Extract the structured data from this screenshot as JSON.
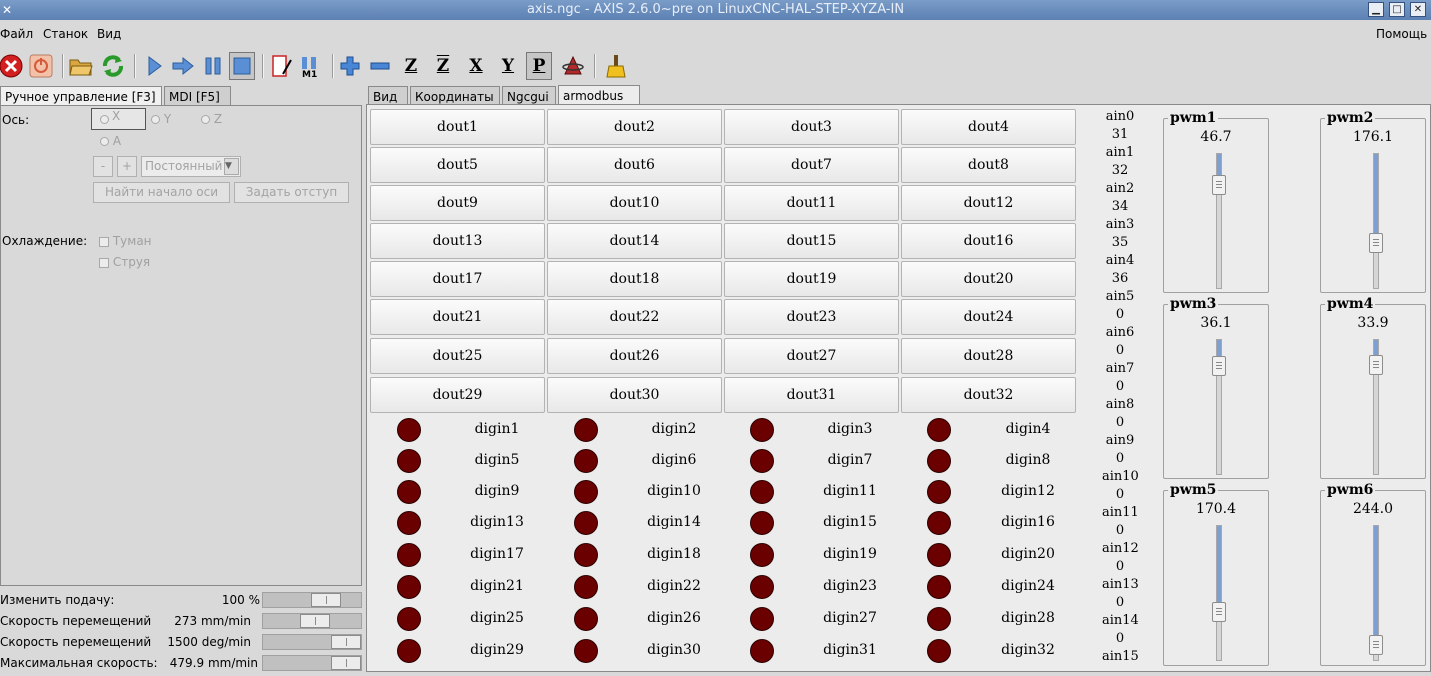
{
  "window": {
    "title": "axis.ngc - AXIS 2.6.0~pre on LinuxCNC-HAL-STEP-XYZA-IN"
  },
  "menubar": {
    "items": [
      "Файл",
      "Станок",
      "Вид"
    ],
    "help": "Помощь"
  },
  "toolbar": {
    "icons": [
      "estop-icon",
      "power-icon",
      "open-file-icon",
      "reload-icon",
      "run-icon",
      "step-icon",
      "pause-icon",
      "stop-icon",
      "block-delete-icon",
      "optional-stop-icon",
      "zoom-in-icon",
      "zoom-out-icon",
      "view-z-icon",
      "view-z2-icon",
      "view-x-icon",
      "view-y-icon",
      "view-p-icon",
      "rotate-icon",
      "clear-live-plot-icon"
    ],
    "view_labels": [
      "Z",
      "Z",
      "X",
      "Y",
      "P"
    ]
  },
  "left_tabs": [
    "Ручное управление [F3]",
    "MDI [F5]"
  ],
  "manual": {
    "axis_label": "Ось:",
    "axes": [
      "X",
      "Y",
      "Z",
      "A"
    ],
    "minus": "-",
    "plus": "+",
    "jog_mode": "Постоянный",
    "home_btn": "Найти начало оси",
    "touch_off_btn": "Задать отступ",
    "coolant_label": "Охлаждение:",
    "mist": "Туман",
    "flood": "Струя"
  },
  "sliders": [
    {
      "label": "Изменить подачу:",
      "value": "100 %",
      "level": 0.7
    },
    {
      "label": "Скорость перемещений",
      "value": "273 mm/min",
      "level": 0.55
    },
    {
      "label": "Скорость перемещений",
      "value": "1500 deg/min",
      "level": 1.0
    },
    {
      "label": "Максимальная скорость:",
      "value": "479.9 mm/min",
      "level": 1.0
    }
  ],
  "right_tabs": [
    "Вид",
    "Координаты",
    "Ngcgui",
    "armodbus"
  ],
  "douts": [
    "dout1",
    "dout2",
    "dout3",
    "dout4",
    "dout5",
    "dout6",
    "dout7",
    "dout8",
    "dout9",
    "dout10",
    "dout11",
    "dout12",
    "dout13",
    "dout14",
    "dout15",
    "dout16",
    "dout17",
    "dout18",
    "dout19",
    "dout20",
    "dout21",
    "dout22",
    "dout23",
    "dout24",
    "dout25",
    "dout26",
    "dout27",
    "dout28",
    "dout29",
    "dout30",
    "dout31",
    "dout32"
  ],
  "digins": [
    "digin1",
    "digin2",
    "digin3",
    "digin4",
    "digin5",
    "digin6",
    "digin7",
    "digin8",
    "digin9",
    "digin10",
    "digin11",
    "digin12",
    "digin13",
    "digin14",
    "digin15",
    "digin16",
    "digin17",
    "digin18",
    "digin19",
    "digin20",
    "digin21",
    "digin22",
    "digin23",
    "digin24",
    "digin25",
    "digin26",
    "digin27",
    "digin28",
    "digin29",
    "digin30",
    "digin31",
    "digin32"
  ],
  "led_color": "#6b0000",
  "ains": [
    {
      "name": "ain0",
      "value": "31"
    },
    {
      "name": "ain1",
      "value": "32"
    },
    {
      "name": "ain2",
      "value": "34"
    },
    {
      "name": "ain3",
      "value": "35"
    },
    {
      "name": "ain4",
      "value": "36"
    },
    {
      "name": "ain5",
      "value": "0"
    },
    {
      "name": "ain6",
      "value": "0"
    },
    {
      "name": "ain7",
      "value": "0"
    },
    {
      "name": "ain8",
      "value": "0"
    },
    {
      "name": "ain9",
      "value": "0"
    },
    {
      "name": "ain10",
      "value": "0"
    },
    {
      "name": "ain11",
      "value": "0"
    },
    {
      "name": "ain12",
      "value": "0"
    },
    {
      "name": "ain13",
      "value": "0"
    },
    {
      "name": "ain14",
      "value": "0"
    },
    {
      "name": "ain15",
      "value": ""
    }
  ],
  "pwms": [
    {
      "name": "pwm1",
      "value": "46.7",
      "fill": 0.18
    },
    {
      "name": "pwm2",
      "value": "176.1",
      "fill": 0.69
    },
    {
      "name": "pwm3",
      "value": "36.1",
      "fill": 0.14
    },
    {
      "name": "pwm4",
      "value": "33.9",
      "fill": 0.13
    },
    {
      "name": "pwm5",
      "value": "170.4",
      "fill": 0.67
    },
    {
      "name": "pwm6",
      "value": "244.0",
      "fill": 0.96
    }
  ]
}
